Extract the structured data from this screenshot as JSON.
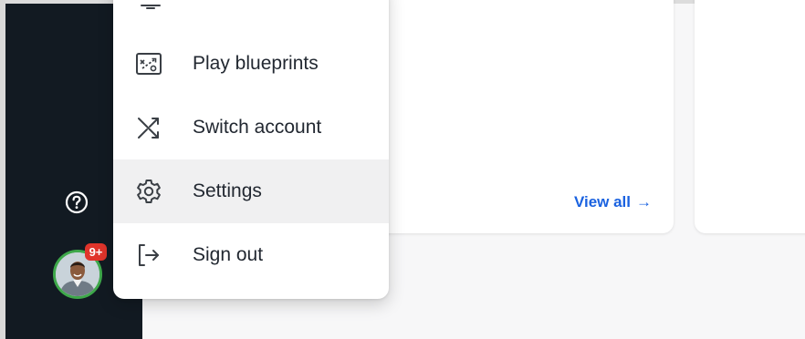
{
  "sidebar": {
    "help_icon": "question-circle-icon",
    "avatar_icon": "user-avatar",
    "notification_badge": "9+"
  },
  "menu": {
    "items": [
      {
        "label": "Play blueprints",
        "icon": "blueprint-icon"
      },
      {
        "label": "Switch account",
        "icon": "shuffle-icon"
      },
      {
        "label": "Settings",
        "icon": "gear-icon",
        "highlighted": true
      },
      {
        "label": "Sign out",
        "icon": "sign-out-icon"
      }
    ]
  },
  "card": {
    "view_all_label": "View all",
    "view_all_arrow": "→"
  },
  "colors": {
    "sidebar_bg": "#121a22",
    "badge": "#e0342b",
    "avatar_ring": "#3ea84a",
    "link": "#1a62e0",
    "menu_highlight": "#f0f0f1"
  }
}
